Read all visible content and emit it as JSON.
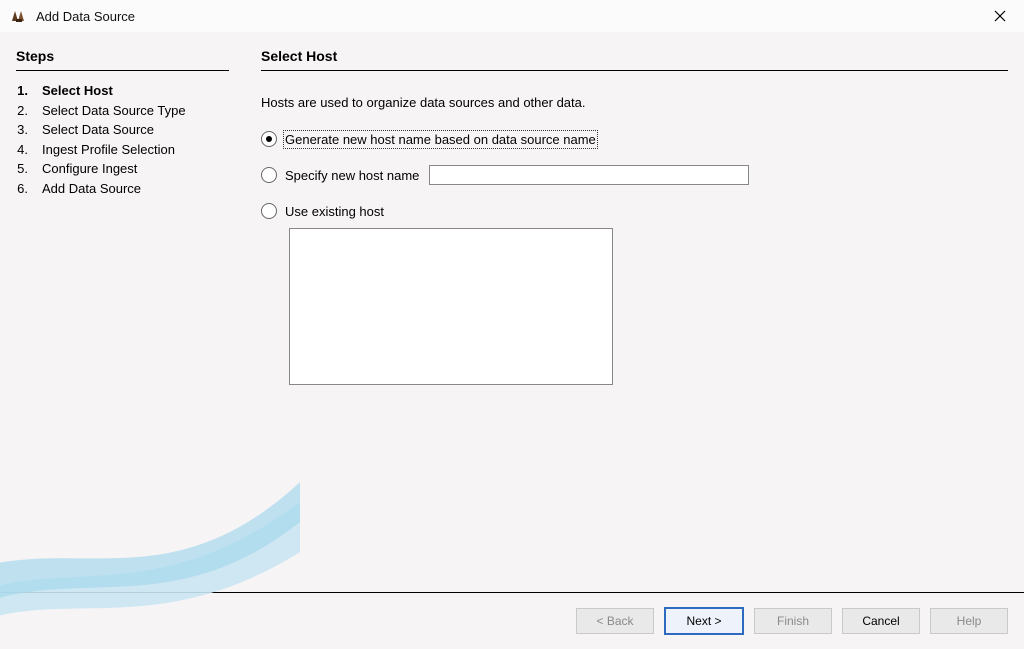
{
  "window": {
    "title": "Add Data Source"
  },
  "sidebar": {
    "heading": "Steps",
    "steps": [
      {
        "num": "1.",
        "label": "Select Host",
        "active": true
      },
      {
        "num": "2.",
        "label": "Select Data Source Type"
      },
      {
        "num": "3.",
        "label": "Select Data Source"
      },
      {
        "num": "4.",
        "label": "Ingest Profile Selection"
      },
      {
        "num": "5.",
        "label": "Configure Ingest"
      },
      {
        "num": "6.",
        "label": "Add Data Source"
      }
    ]
  },
  "content": {
    "heading": "Select Host",
    "intro": "Hosts are used to organize data sources and other data.",
    "options": {
      "generate": "Generate new host name based on data source name",
      "specify": "Specify new host name",
      "existing": "Use existing host"
    },
    "specify_value": ""
  },
  "buttons": {
    "back": "< Back",
    "next": "Next >",
    "finish": "Finish",
    "cancel": "Cancel",
    "help": "Help"
  }
}
